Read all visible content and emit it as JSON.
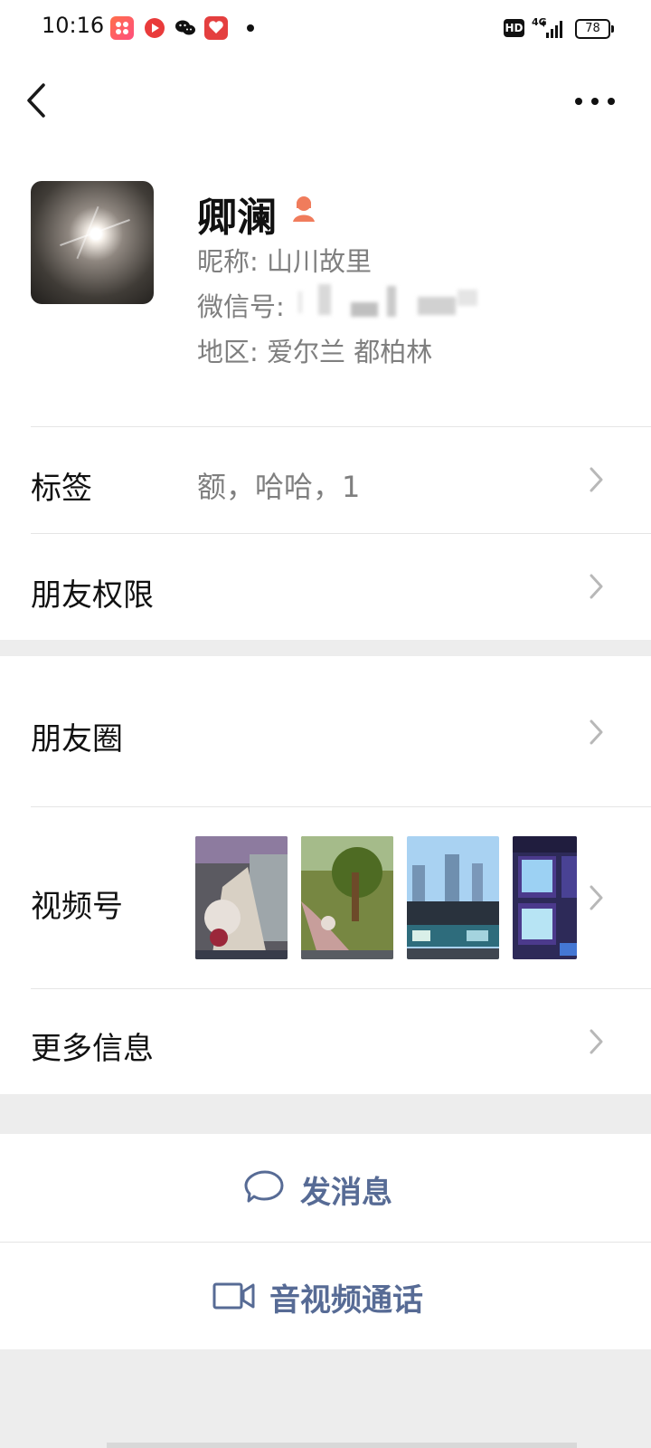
{
  "status_bar": {
    "time": "10:16",
    "hd": "HD",
    "network": "4G",
    "battery": "78"
  },
  "profile": {
    "name": "卿澜",
    "gender_icon": "female-user-icon",
    "nickname_label": "昵称:",
    "nickname_value": "山川故里",
    "wechat_id_label": "微信号:",
    "region_label": "地区:",
    "region_value": "爱尔兰 都柏林"
  },
  "rows": {
    "tags_label": "标签",
    "tags_value": "额，哈哈，1",
    "friend_permission_label": "朋友权限",
    "moments_label": "朋友圈",
    "channels_label": "视频号",
    "more_info_label": "更多信息"
  },
  "actions": {
    "send_message": "发消息",
    "audio_video_call": "音视频通话"
  },
  "colors": {
    "accent": "#576b95",
    "background": "#ededed",
    "gender": "#f07c5c"
  }
}
